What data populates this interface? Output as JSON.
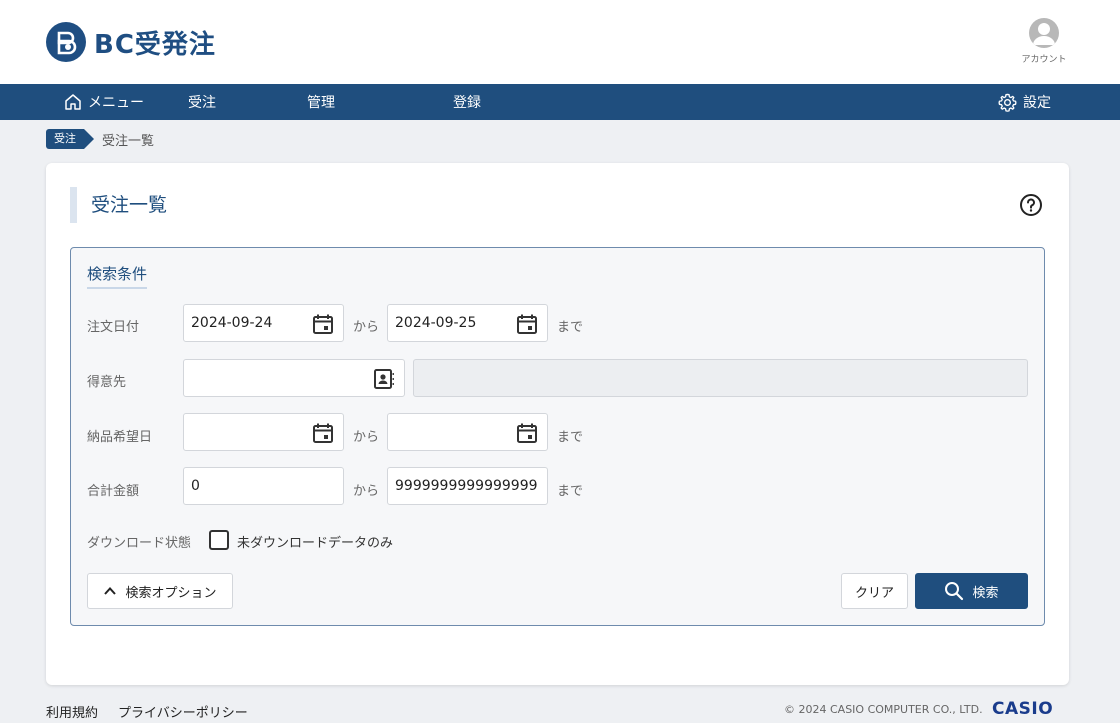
{
  "app": {
    "logo_text": "BC受発注",
    "account_label": "アカウント"
  },
  "nav": {
    "menu": "メニュー",
    "order": "受注",
    "management": "管理",
    "registration": "登録",
    "settings": "設定"
  },
  "breadcrumb": {
    "parent": "受注",
    "current": "受注一覧"
  },
  "page": {
    "title": "受注一覧"
  },
  "search": {
    "title": "検索条件",
    "order_date_label": "注文日付",
    "order_date_from": "2024-09-24",
    "order_date_to": "2024-09-25",
    "customer_label": "得意先",
    "customer_code": "",
    "customer_name": "",
    "delivery_date_label": "納品希望日",
    "delivery_date_from": "",
    "delivery_date_to": "",
    "total_label": "合計金額",
    "total_from": "0",
    "total_to": "9999999999999999",
    "download_status_label": "ダウンロード状態",
    "download_checkbox_label": "未ダウンロードデータのみ",
    "download_checked": false,
    "sep_from": "から",
    "sep_to": "まで",
    "options_button": "検索オプション",
    "clear_button": "クリア",
    "search_button": "検索"
  },
  "footer": {
    "terms": "利用規約",
    "privacy": "プライバシーポリシー",
    "copyright": "© 2024 CASIO COMPUTER CO., LTD.",
    "brand": "CASIO"
  },
  "colors": {
    "primary": "#1f4e7e",
    "background": "#eef0f3"
  }
}
